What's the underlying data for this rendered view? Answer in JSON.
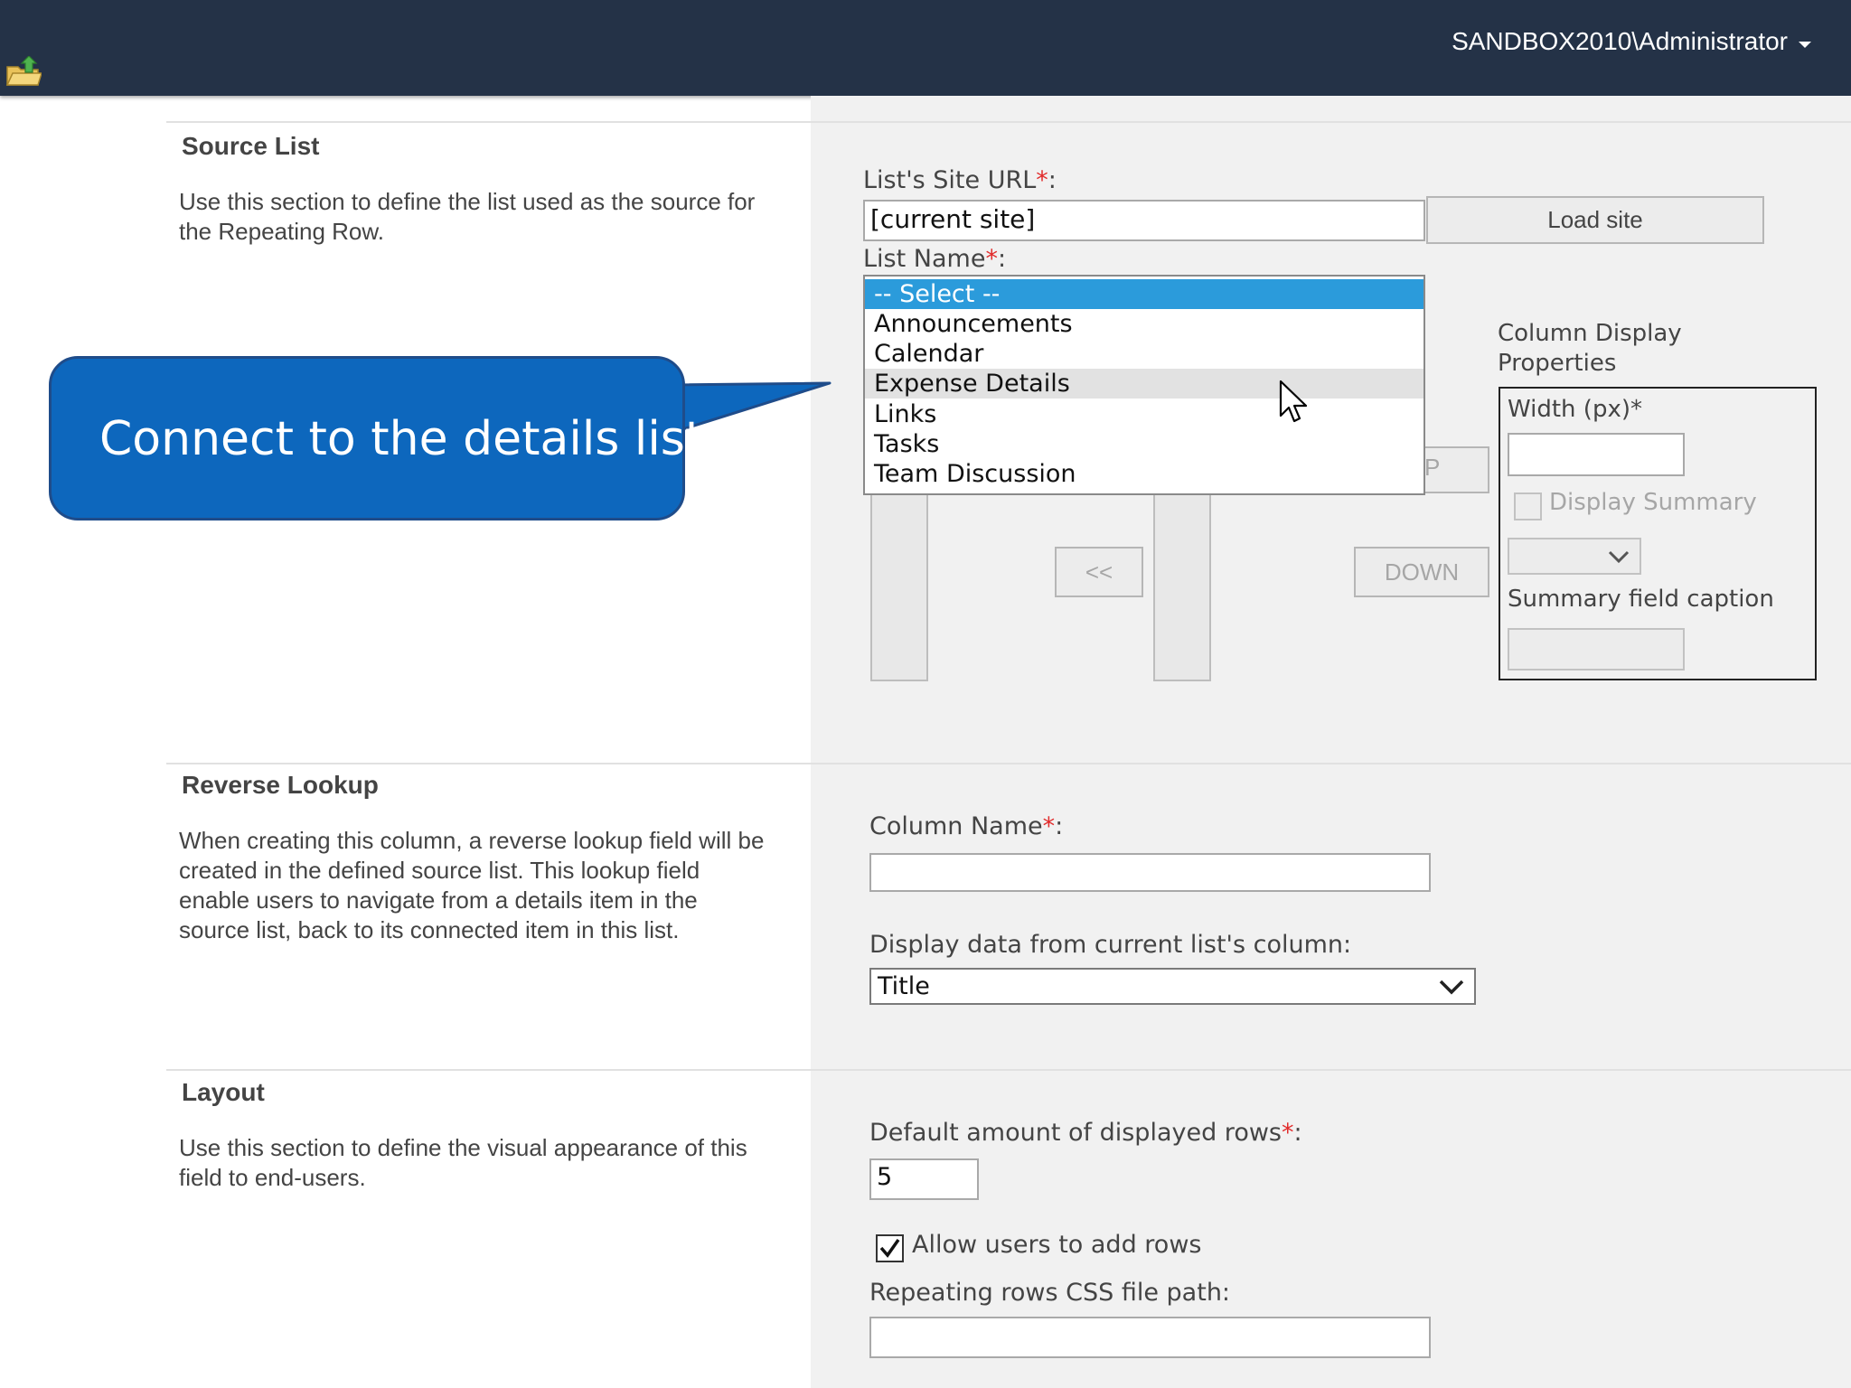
{
  "header": {
    "user_name": "SANDBOX2010\\Administrator"
  },
  "sections": {
    "source_list": {
      "title": "Source List",
      "description": "Use this section to define the list used as the source for the Repeating Row."
    },
    "reverse_lookup": {
      "title": "Reverse Lookup",
      "description": "When creating this column, a reverse lookup field will be created in the defined source list. This lookup field enable users to navigate from a details item in the source list, back to its connected item in this list."
    },
    "layout": {
      "title": "Layout",
      "description": "Use this section to define the visual appearance of this field to end-users."
    }
  },
  "source_form": {
    "site_url_label": "List's Site URL",
    "site_url_value": "[current site]",
    "load_site_label": "Load site",
    "list_name_label": "List Name",
    "list_options": [
      "-- Select --",
      "Announcements",
      "Calendar",
      "Expense Details",
      "Links",
      "Tasks",
      "Team Discussion"
    ],
    "selected_option": "-- Select --",
    "hovered_option": "Expense Details",
    "move_left_label": "<<",
    "up_label_fragment": "P",
    "down_label": "DOWN",
    "column_display_title": "Column Display Properties",
    "width_label": "Width (px)*",
    "width_value": "",
    "display_summary_label": "Display Summary",
    "summary_caption_label": "Summary field caption"
  },
  "reverse_form": {
    "column_name_label": "Column Name",
    "column_name_value": "",
    "display_data_label": "Display data from current list's column:",
    "display_data_value": "Title"
  },
  "layout_form": {
    "default_rows_label": "Default amount of displayed rows",
    "default_rows_value": "5",
    "allow_add_rows_label": "Allow users to add rows",
    "allow_add_rows_checked": true,
    "css_path_label": "Repeating rows CSS file path:",
    "css_path_value": ""
  },
  "callout": {
    "text": "Connect to the details list"
  },
  "colors": {
    "header_bg": "#243247",
    "selection": "#2b9bdb",
    "callout": "#0d67bd",
    "required": "#e12b2b"
  }
}
